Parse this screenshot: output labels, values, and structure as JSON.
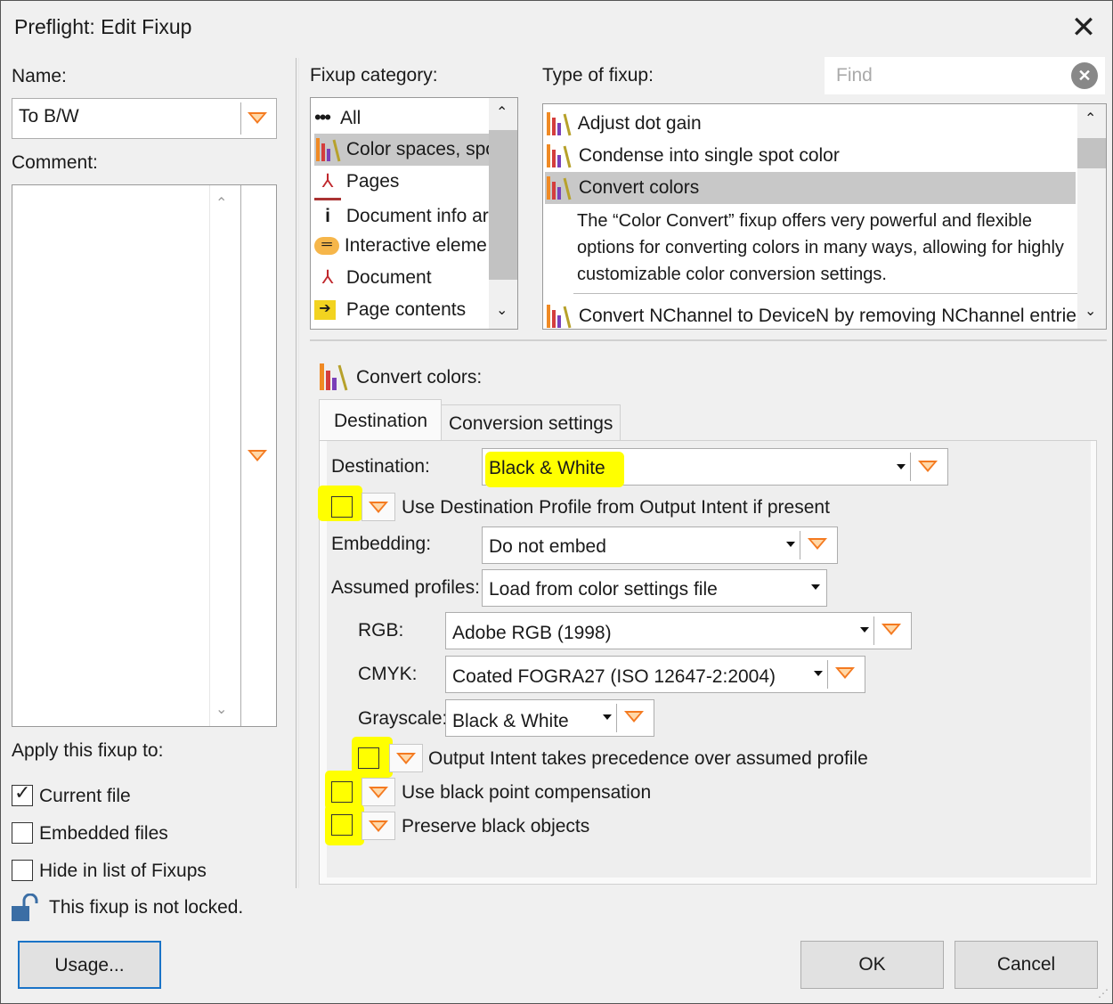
{
  "window": {
    "title": "Preflight: Edit Fixup"
  },
  "left": {
    "name_label": "Name:",
    "name_value": "To B/W",
    "comment_label": "Comment:",
    "apply_label": "Apply this fixup to:",
    "checks": [
      {
        "label": "Current file",
        "checked": true
      },
      {
        "label": "Embedded files",
        "checked": false
      },
      {
        "label": "Hide in list of Fixups",
        "checked": false
      }
    ],
    "lock_text": "This fixup is not locked."
  },
  "category": {
    "label": "Fixup category:",
    "items": [
      {
        "label": "All",
        "icon": "dots-icon"
      },
      {
        "label": "Color spaces, spo",
        "icon": "color-space-icon",
        "selected": true
      },
      {
        "label": "Pages",
        "icon": "pdf-icon"
      },
      {
        "label": "Document info ar",
        "icon": "info-icon"
      },
      {
        "label": "Interactive eleme",
        "icon": "comment-icon"
      },
      {
        "label": "Document",
        "icon": "pdf-icon"
      },
      {
        "label": "Page contents",
        "icon": "arrow-icon"
      }
    ]
  },
  "type": {
    "label": "Type of fixup:",
    "find_placeholder": "Find",
    "items": [
      {
        "label": "Adjust dot gain"
      },
      {
        "label": "Condense into single spot color"
      },
      {
        "label": "Convert colors",
        "selected": true
      },
      {
        "label": "Convert NChannel to DeviceN by removing NChannel entries"
      }
    ],
    "description": "The “Color Convert” fixup offers very powerful and flexible options for converting colors in many ways, allowing for highly customizable color conversion settings."
  },
  "panel": {
    "heading": "Convert colors:",
    "tabs": [
      {
        "label": "Destination",
        "active": true
      },
      {
        "label": "Conversion settings",
        "active": false
      }
    ],
    "destination_label": "Destination:",
    "destination_value": "Black & White",
    "use_dest_profile": "Use Destination Profile from Output Intent if present",
    "embedding_label": "Embedding:",
    "embedding_value": "Do not embed",
    "assumed_label": "Assumed profiles:",
    "assumed_value": "Load from color settings file",
    "rgb_label": "RGB:",
    "rgb_value": "Adobe RGB (1998)",
    "cmyk_label": "CMYK:",
    "cmyk_value": "Coated FOGRA27 (ISO 12647-2:2004)",
    "gray_label": "Grayscale:",
    "gray_value": "Black & White",
    "output_intent": "Output Intent takes precedence over assumed profile",
    "black_point": "Use black point compensation",
    "preserve_black": "Preserve black objects"
  },
  "buttons": {
    "usage": "Usage...",
    "ok": "OK",
    "cancel": "Cancel"
  },
  "colors": {
    "accent_orange": "#f47a20",
    "highlight": "#ffff00",
    "selection": "#c8c8c8"
  }
}
